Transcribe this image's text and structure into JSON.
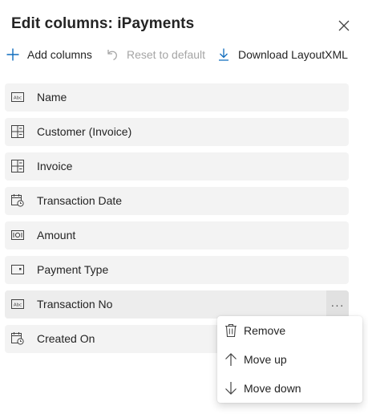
{
  "dialog": {
    "title": "Edit columns: iPayments",
    "close_icon": "close-icon"
  },
  "toolbar": {
    "add_label": "Add columns",
    "reset_label": "Reset to default",
    "reset_disabled": true,
    "download_label": "Download LayoutXML"
  },
  "columns": [
    {
      "label": "Name",
      "icon": "text-field-icon"
    },
    {
      "label": "Customer (Invoice)",
      "icon": "lookup-icon"
    },
    {
      "label": "Invoice",
      "icon": "lookup-icon"
    },
    {
      "label": "Transaction Date",
      "icon": "calendar-icon"
    },
    {
      "label": "Amount",
      "icon": "currency-icon"
    },
    {
      "label": "Payment Type",
      "icon": "option-set-icon"
    },
    {
      "label": "Transaction No",
      "icon": "text-field-icon",
      "hovered": true
    },
    {
      "label": "Created On",
      "icon": "calendar-icon"
    }
  ],
  "more_button": {
    "glyph": "···"
  },
  "context_menu": {
    "items": [
      {
        "label": "Remove",
        "icon": "trash-icon"
      },
      {
        "label": "Move up",
        "icon": "arrow-up-icon"
      },
      {
        "label": "Move down",
        "icon": "arrow-down-icon"
      }
    ]
  },
  "colors": {
    "row_background": "#f3f3f3",
    "disabled_text": "#a5a5a5",
    "text": "#242424"
  }
}
